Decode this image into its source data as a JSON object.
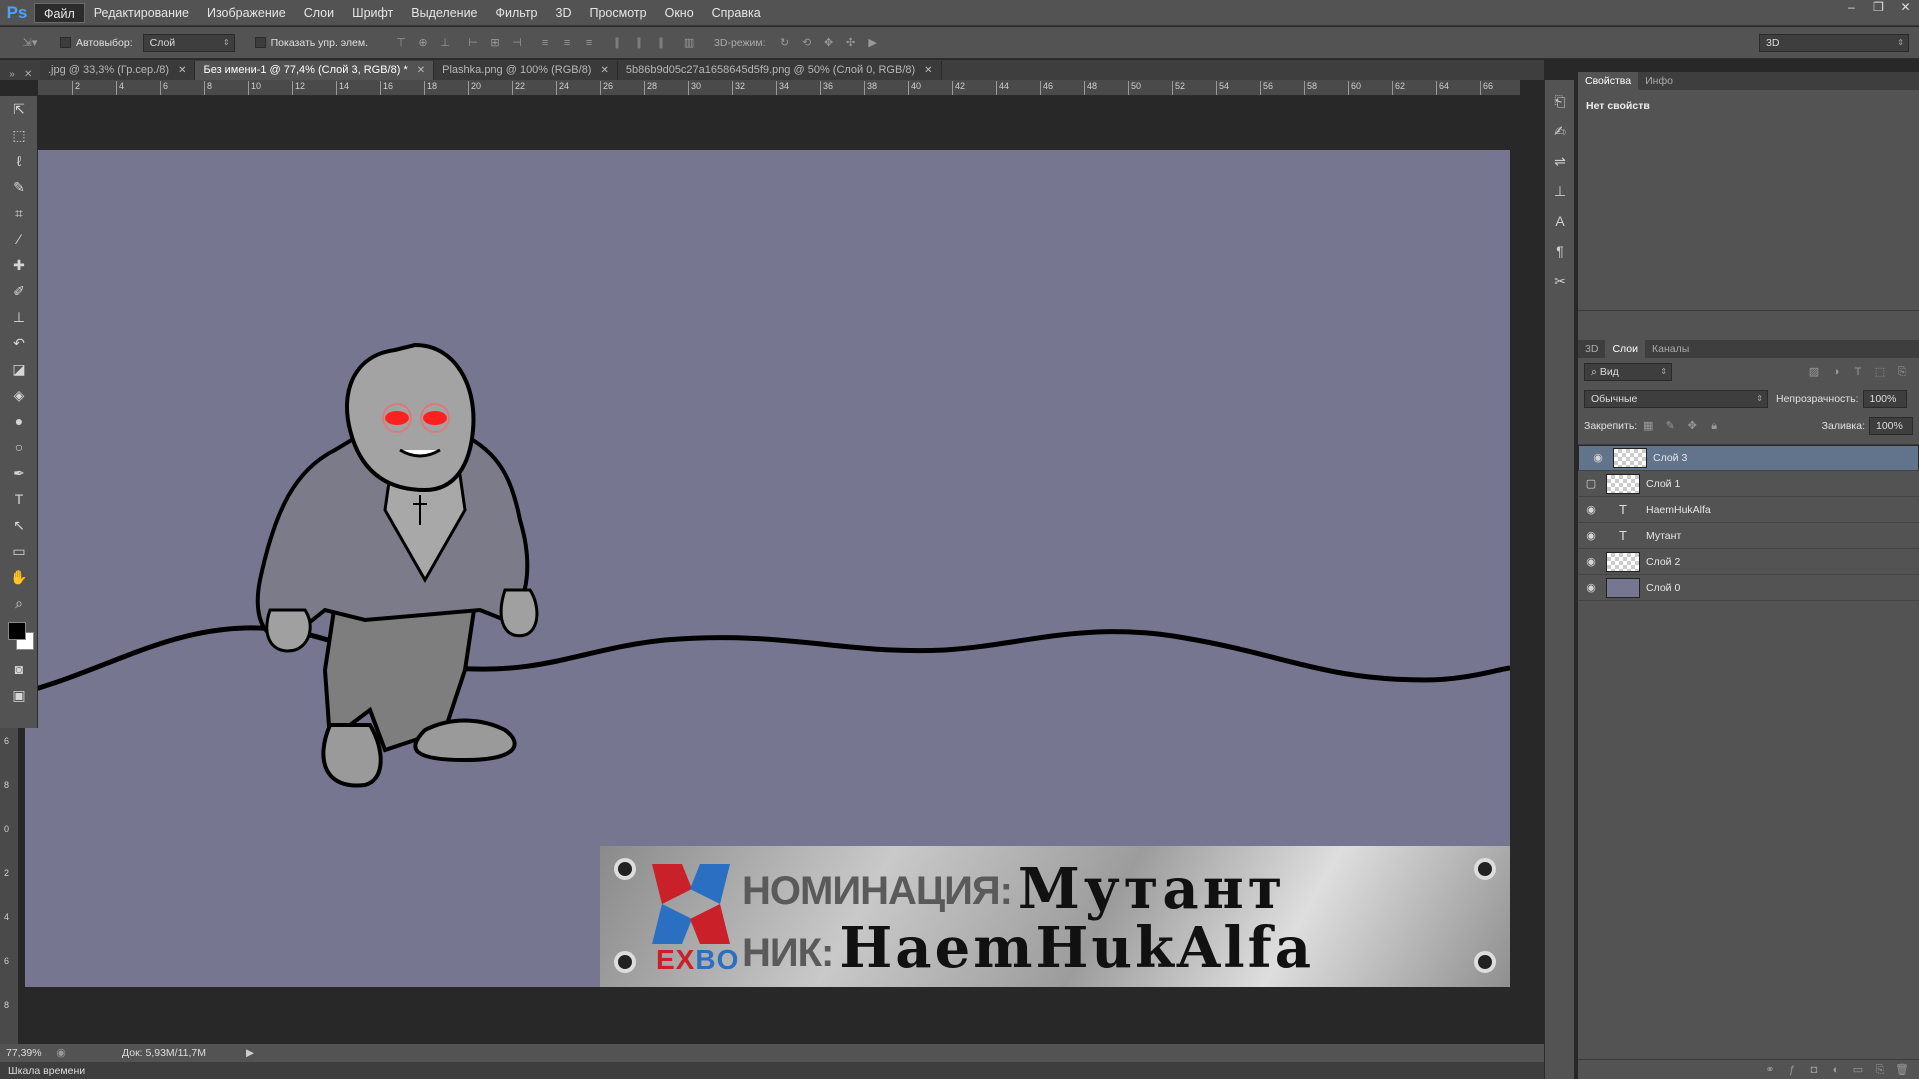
{
  "app": {
    "logo": "Ps"
  },
  "menu": [
    "Файл",
    "Редактирование",
    "Изображение",
    "Слои",
    "Шрифт",
    "Выделение",
    "Фильтр",
    "3D",
    "Просмотр",
    "Окно",
    "Справка"
  ],
  "window_controls": [
    "–",
    "❐",
    "✕"
  ],
  "options": {
    "autoselect_label": "Автовыбор:",
    "autoselect_value": "Слой",
    "show_transform_label": "Показать упр. элем.",
    "mode3d_label": "3D-режим:",
    "workspace_value": "3D"
  },
  "tabs": [
    {
      "label": ".jpg @ 33,3% (Гр.сер./8)",
      "active": false
    },
    {
      "label": "Без имени-1 @ 77,4% (Слой 3, RGB/8) *",
      "active": true
    },
    {
      "label": "Plashka.png @ 100% (RGB/8)",
      "active": false
    },
    {
      "label": "5b86b9d05c27a1658645d5f9.png @ 50% (Слой 0, RGB/8)",
      "active": false
    }
  ],
  "ruler_h": [
    "2",
    "4",
    "6",
    "8",
    "10",
    "12",
    "14",
    "16",
    "18",
    "20",
    "22",
    "24",
    "26",
    "28",
    "30",
    "32",
    "34",
    "36",
    "38",
    "40",
    "42",
    "44",
    "46",
    "48",
    "50",
    "52",
    "54",
    "56",
    "58",
    "60",
    "62",
    "64",
    "66"
  ],
  "ruler_v": [
    "6",
    "8",
    "0",
    "2",
    "4",
    "6",
    "8"
  ],
  "banner": {
    "label1": "НОМИНАЦИЯ:",
    "value1": "Мутант",
    "label2": "НИК:",
    "value2": "HaemHukAlfa",
    "logo_text": "EXBO"
  },
  "status": {
    "zoom": "77,39%",
    "doc": "Док: 5,93M/11,7M"
  },
  "timeline_label": "Шкала времени",
  "properties": {
    "tabs": [
      "Свойства",
      "Инфо"
    ],
    "empty_text": "Нет свойств"
  },
  "layers_panel": {
    "tabs": [
      "3D",
      "Слои",
      "Каналы"
    ],
    "search": "Вид",
    "blend_mode": "Обычные",
    "opacity_label": "Непрозрачность:",
    "opacity_value": "100%",
    "lock_label": "Закрепить:",
    "fill_label": "Заливка:",
    "fill_value": "100%",
    "layers": [
      {
        "name": "Слой 3",
        "type": "raster",
        "visible": true,
        "selected": true
      },
      {
        "name": "Слой 1",
        "type": "raster",
        "visible": false,
        "selected": false
      },
      {
        "name": "HaemHukAlfa",
        "type": "text",
        "visible": true,
        "selected": false
      },
      {
        "name": "Мутант",
        "type": "text",
        "visible": true,
        "selected": false
      },
      {
        "name": "Слой 2",
        "type": "raster",
        "visible": true,
        "selected": false
      },
      {
        "name": "Слой 0",
        "type": "fill",
        "visible": true,
        "selected": false
      }
    ]
  },
  "colors": {
    "canvas": "#767690",
    "selected_layer": "#62738c",
    "eyes": "#ff2020"
  }
}
